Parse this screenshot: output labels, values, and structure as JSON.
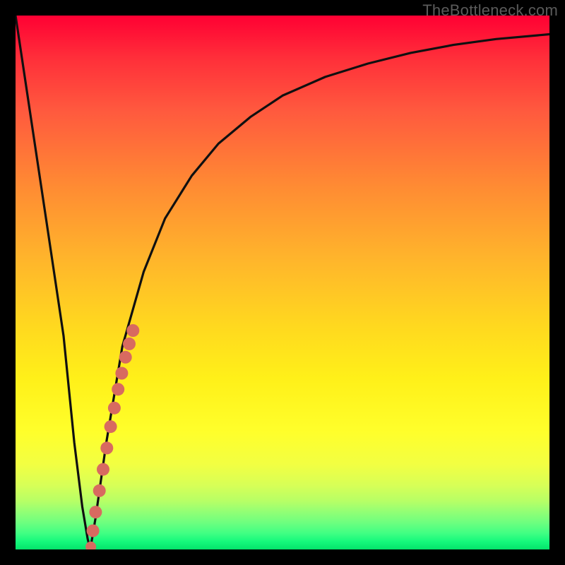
{
  "watermark": "TheBottleneck.com",
  "chart_data": {
    "type": "line",
    "title": "",
    "xlabel": "",
    "ylabel": "",
    "xlim": [
      0,
      100
    ],
    "ylim": [
      0,
      100
    ],
    "grid": false,
    "series": [
      {
        "name": "bottleneck-curve",
        "x": [
          0,
          3,
          6,
          9,
          11,
          12.5,
          13.5,
          14,
          15,
          17,
          20,
          24,
          28,
          33,
          38,
          44,
          50,
          58,
          66,
          74,
          82,
          90,
          100
        ],
        "y": [
          100,
          80,
          60,
          40,
          20,
          8,
          2,
          0,
          6,
          20,
          38,
          52,
          62,
          70,
          76,
          81,
          85,
          88.5,
          91,
          93,
          94.5,
          95.6,
          96.5
        ]
      }
    ],
    "highlight_points": {
      "name": "selected-range",
      "color": "#d86a60",
      "x": [
        14.1,
        14.5,
        15.0,
        15.7,
        16.4,
        17.1,
        17.8,
        18.5,
        19.2,
        19.9,
        20.6,
        21.3,
        22.0
      ],
      "y": [
        0.5,
        3.5,
        7.0,
        11.0,
        15.0,
        19.0,
        23.0,
        26.5,
        30.0,
        33.0,
        36.0,
        38.5,
        41.0
      ]
    }
  },
  "colors": {
    "curve_stroke": "#101010",
    "dot_fill": "#d86a60"
  }
}
